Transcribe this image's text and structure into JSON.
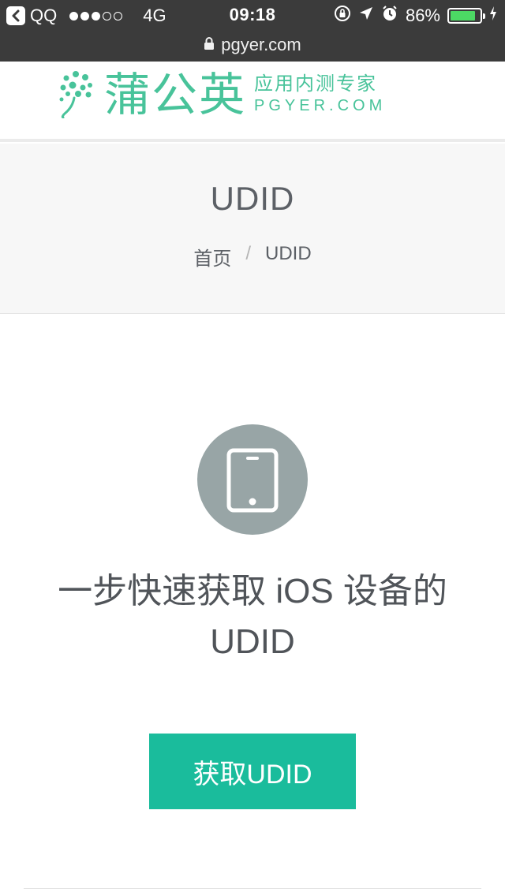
{
  "status_bar": {
    "back_app": "QQ",
    "network": "4G",
    "time": "09:18",
    "battery_percent": "86%",
    "battery_level": 0.86,
    "battery_color": "#4cd964",
    "signal_dots_filled": 3,
    "signal_dots_total": 5,
    "icons": [
      "back-arrow-icon",
      "rotation-lock-icon",
      "location-arrow-icon",
      "alarm-clock-icon",
      "battery-icon",
      "charging-bolt-icon",
      "lock-icon"
    ]
  },
  "address_bar": {
    "url": "pgyer.com"
  },
  "header": {
    "logo_name": "蒲公英",
    "logo_slogan": "应用内测专家",
    "logo_domain": "PGYER.COM",
    "brand_color": "#48c39a"
  },
  "page": {
    "title": "UDID",
    "breadcrumb": {
      "home": "首页",
      "separator": "/",
      "current": "UDID"
    }
  },
  "main": {
    "icon": "tablet-icon",
    "headline_line1": "一步快速获取 iOS 设备的",
    "headline_line2": "UDID",
    "button_label": "获取UDID",
    "button_color": "#1abc9c"
  }
}
